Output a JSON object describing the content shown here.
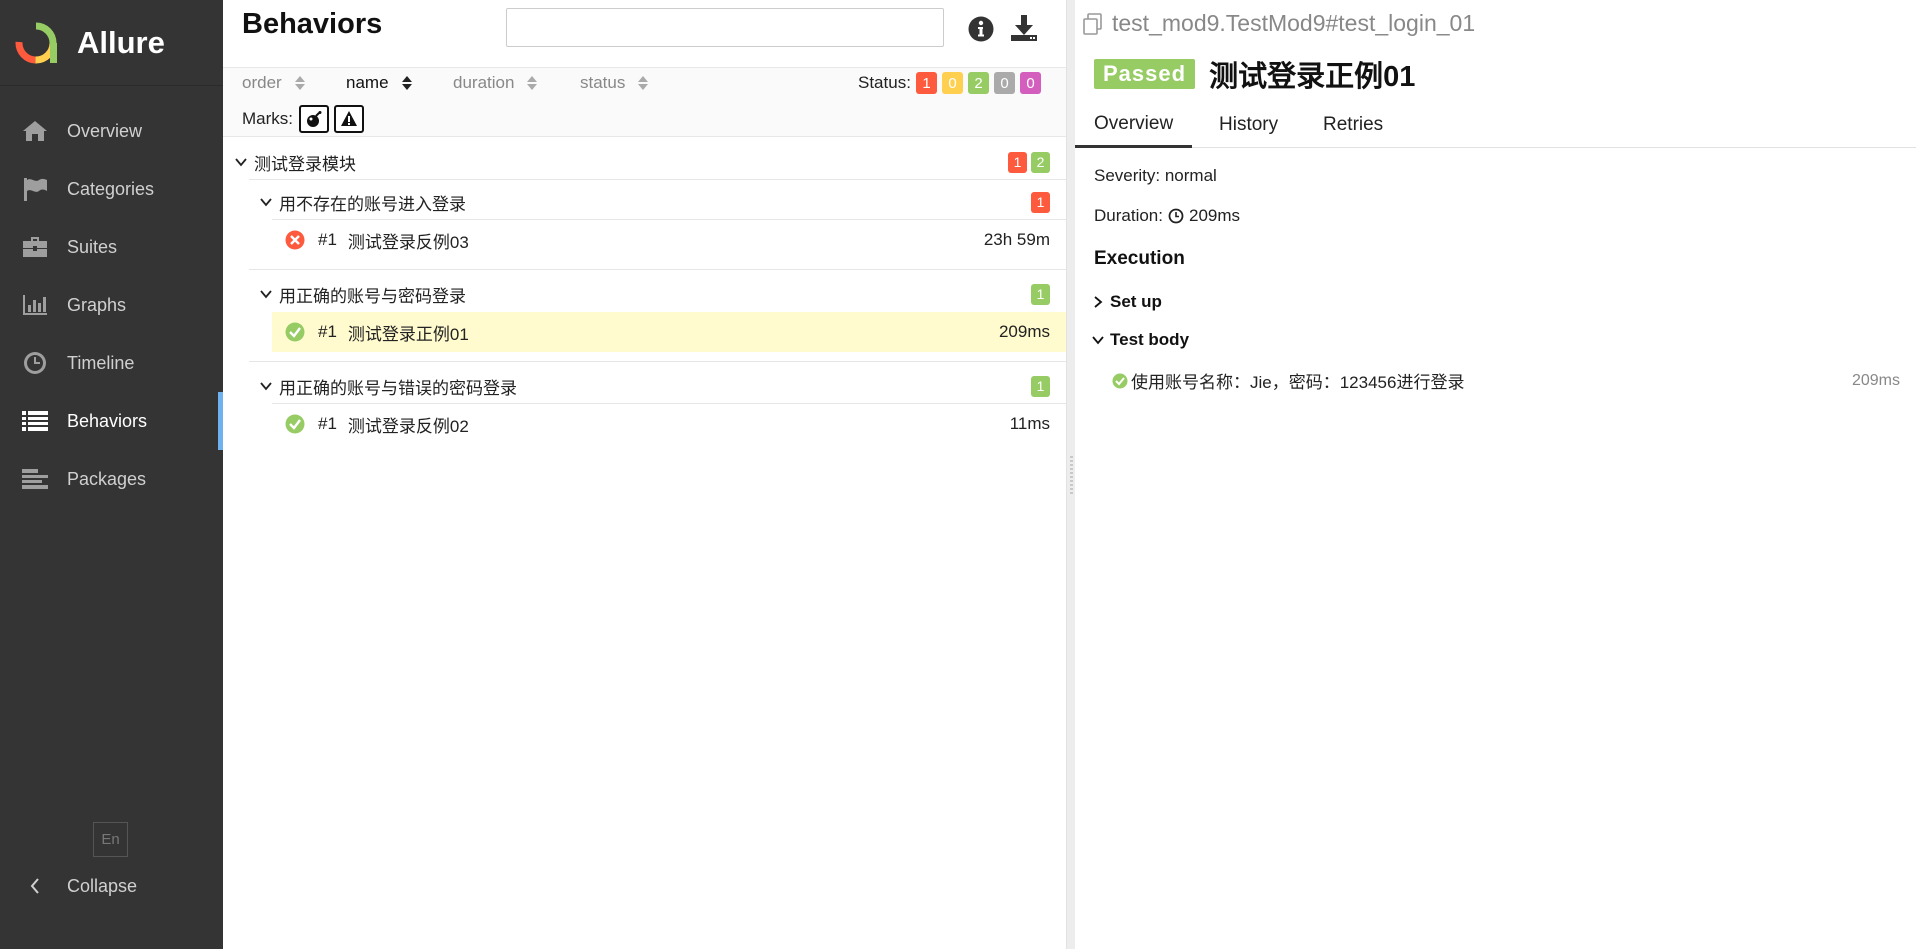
{
  "sidebar": {
    "brand": "Allure",
    "items": [
      {
        "label": "Overview",
        "icon": "home-icon"
      },
      {
        "label": "Categories",
        "icon": "flag-icon"
      },
      {
        "label": "Suites",
        "icon": "briefcase-icon"
      },
      {
        "label": "Graphs",
        "icon": "bar-chart-icon"
      },
      {
        "label": "Timeline",
        "icon": "clock-icon"
      },
      {
        "label": "Behaviors",
        "icon": "list-icon",
        "active": true
      },
      {
        "label": "Packages",
        "icon": "align-left-icon"
      }
    ],
    "language": "En",
    "collapse": "Collapse"
  },
  "left": {
    "title": "Behaviors",
    "search_value": "",
    "sort": {
      "order": "order",
      "name": "name",
      "duration": "duration",
      "status": "status",
      "active": "name"
    },
    "status_label": "Status:",
    "status_counts": {
      "failed": "1",
      "broken": "0",
      "passed": "2",
      "skipped": "0",
      "unknown": "0"
    },
    "marks_label": "Marks:",
    "tree": {
      "root": {
        "label": "测试登录模块",
        "failed": "1",
        "passed": "2"
      },
      "groups": [
        {
          "label": "用不存在的账号进入登录",
          "badge": "1",
          "badge_status": "failed",
          "case": {
            "num": "#1",
            "name": "测试登录反例03",
            "duration": "23h 59m",
            "status": "failed"
          }
        },
        {
          "label": "用正确的账号与密码登录",
          "badge": "1",
          "badge_status": "passed",
          "case": {
            "num": "#1",
            "name": "测试登录正例01",
            "duration": "209ms",
            "status": "passed",
            "selected": true
          }
        },
        {
          "label": "用正确的账号与错误的密码登录",
          "badge": "1",
          "badge_status": "passed",
          "case": {
            "num": "#1",
            "name": "测试登录反例02",
            "duration": "11ms",
            "status": "passed"
          }
        }
      ]
    }
  },
  "right": {
    "path": "test_mod9.TestMod9#test_login_01",
    "status": "Passed",
    "title": "测试登录正例01",
    "tabs": [
      "Overview",
      "History",
      "Retries"
    ],
    "severity": "Severity: normal",
    "duration_label": "Duration:",
    "duration_value": "209ms",
    "execution": "Execution",
    "setup": "Set up",
    "test_body": "Test body",
    "step": {
      "label": "使用账号名称：Jie，密码：123456进行登录",
      "duration": "209ms"
    }
  },
  "colors": {
    "sidebar_bg": "#343434",
    "active_accent": "#6eb3ef",
    "failed": "#fd5a3e",
    "broken": "#ffd050",
    "passed": "#97cc64",
    "skipped": "#aaaaaa",
    "unknown": "#d35ebe",
    "selected_row": "#fffbcf"
  }
}
